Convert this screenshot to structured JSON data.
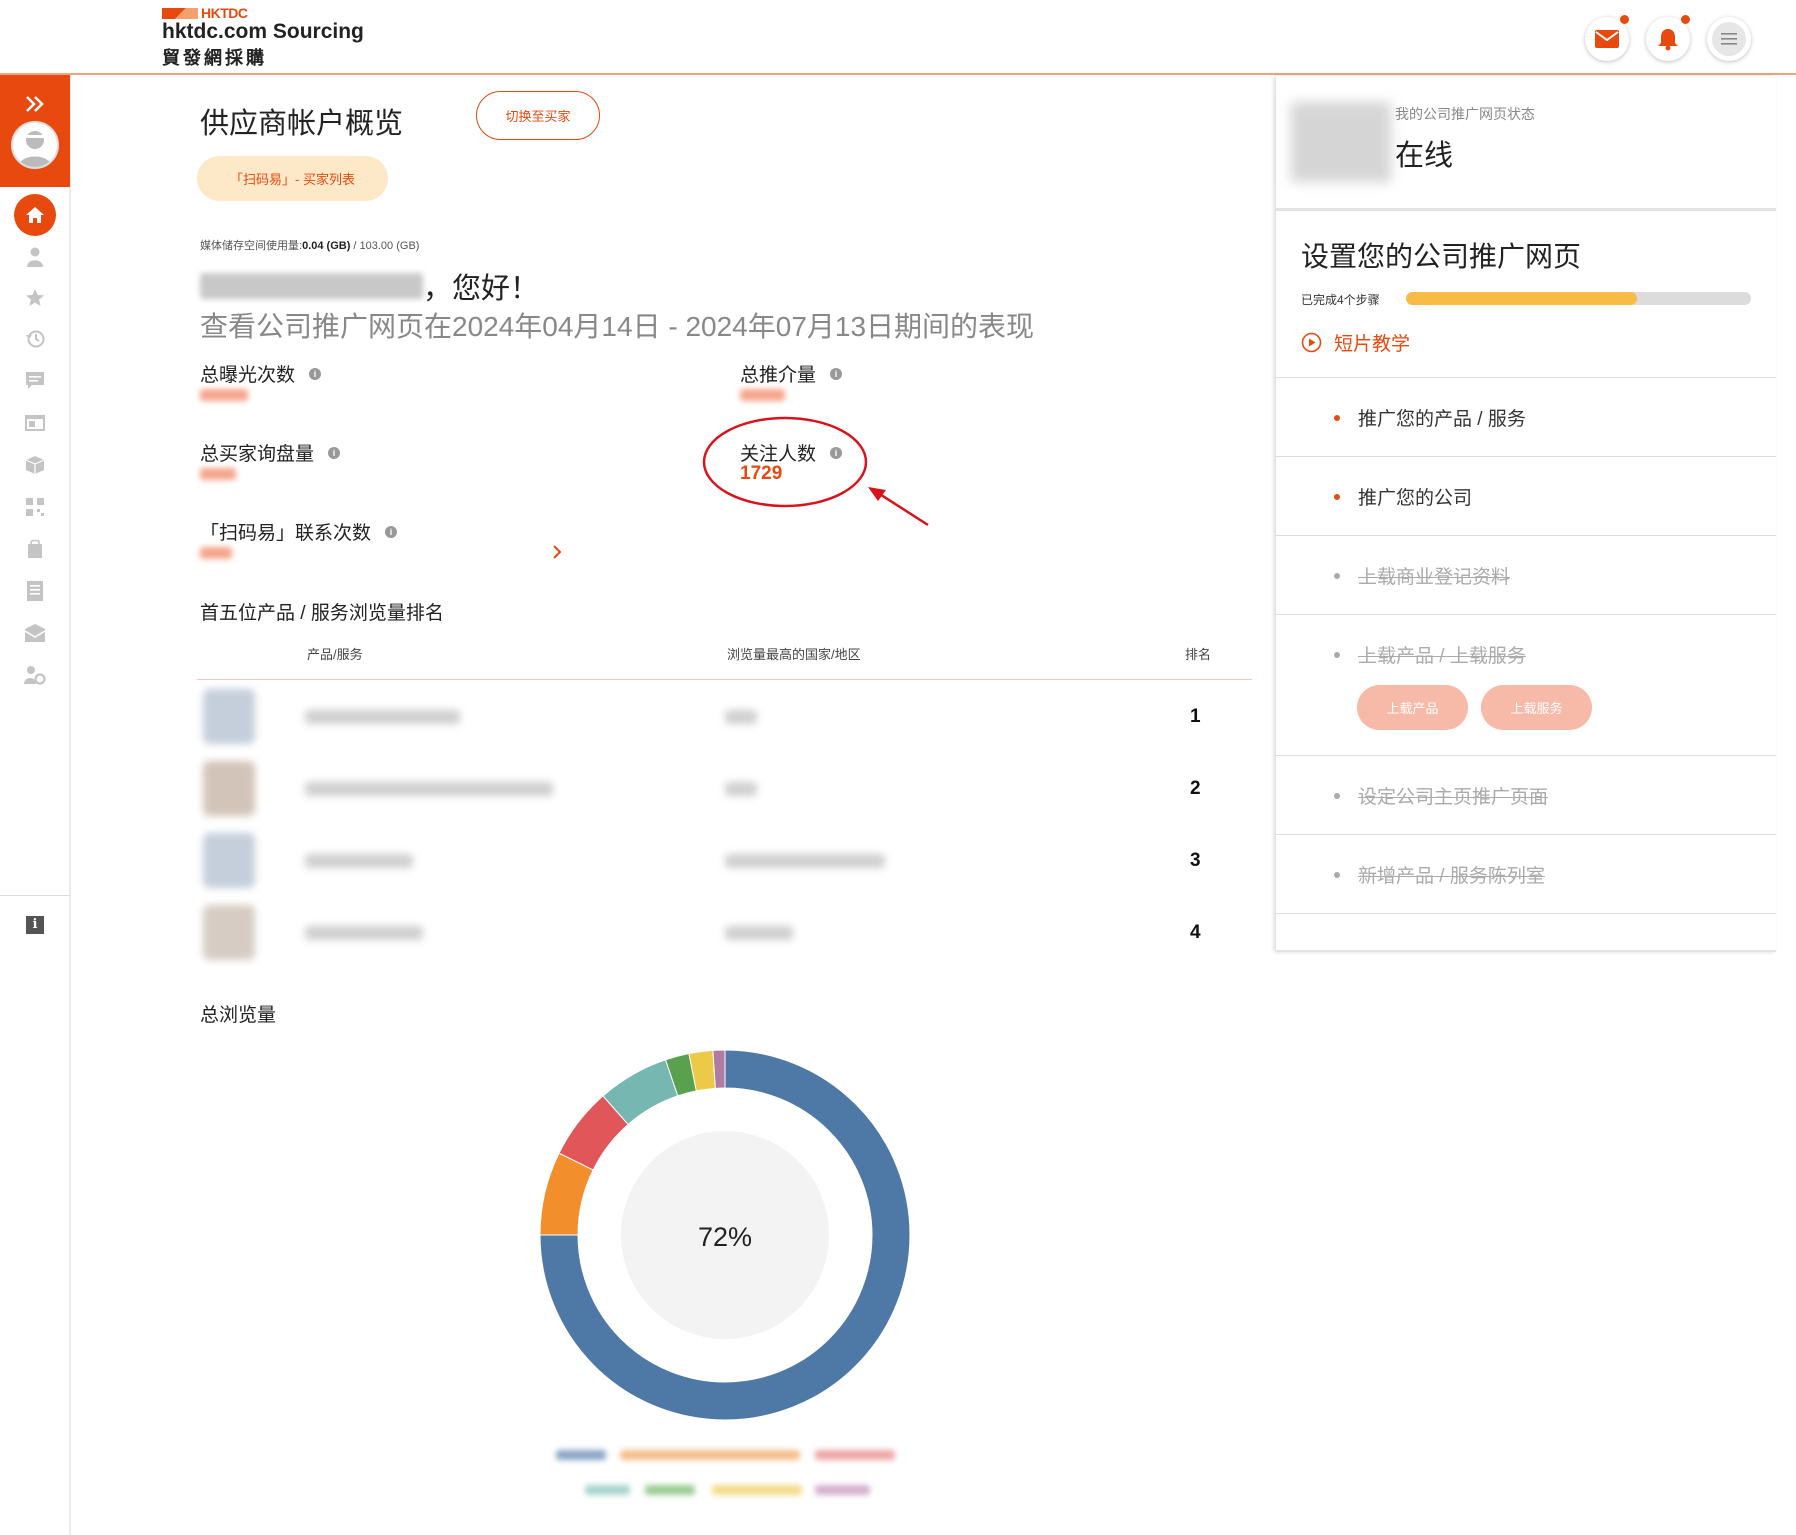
{
  "header": {
    "logo_brand": "HKTDC",
    "logo_main": "hktdc.com Sourcing",
    "logo_sub": "貿發網採購",
    "mail_icon": "mail-icon",
    "bell_icon": "bell-icon",
    "menu_icon": "menu-icon",
    "accent": "#e8490f"
  },
  "sidebar": {
    "items": [
      "expand-icon",
      "avatar",
      "home-icon",
      "user-icon",
      "star-icon",
      "history-icon",
      "message-icon",
      "browser-icon",
      "box-icon",
      "qr-icon",
      "bag-icon",
      "document-icon",
      "inbox-icon",
      "user-settings-icon",
      "info-icon"
    ]
  },
  "main": {
    "title": "供应商帐户概览",
    "switch_button": "切换至买家",
    "scan_pill": "「扫码易」- 买家列表",
    "storage_label": "媒体储存空间使用量:",
    "storage_used": "0.04 (GB)",
    "storage_total": " / 103.00 (GB)",
    "greeting_suffix": "，您好！",
    "subtitle": "查看公司推广网页在2024年04月14日 - 2024年07月13日期间的表现",
    "stats": {
      "exposure_label": "总曝光次数",
      "referral_label": "总推介量",
      "inquiries_label": "总买家询盘量",
      "followers_label": "关注人数",
      "followers_value": "1729",
      "scan_contacts_label": "「扫码易」联系次数"
    },
    "top_products_title": "首五位产品 / 服务浏览量排名",
    "table": {
      "col_product": "产品/服务",
      "col_country": "浏览量最高的国家/地区",
      "col_rank": "排名",
      "ranks": [
        "1",
        "2",
        "3",
        "4"
      ]
    },
    "total_views_title": "总浏览量",
    "donut_center": "72%"
  },
  "chart_data": {
    "type": "pie",
    "title": "",
    "center_label": "72%",
    "series": [
      {
        "values": [
          72,
          7,
          6,
          6,
          2,
          2,
          1
        ]
      }
    ],
    "colors": [
      "#4e79a7",
      "#f28e2b",
      "#e15759",
      "#76b7b2",
      "#59a14f",
      "#edc948",
      "#b07aa1"
    ]
  },
  "right_panel": {
    "status_label": "我的公司推广网页状态",
    "status_value": "在线",
    "setup_title": "设置您的公司推广网页",
    "steps_done": "已完成4个步骤",
    "progress_fraction": 0.67,
    "video_link": "短片教学",
    "tasks": [
      {
        "label": "推广您的产品 / 服务",
        "done": false
      },
      {
        "label": "推广您的公司",
        "done": false
      },
      {
        "label": "上载商业登记资料",
        "done": true
      },
      {
        "label": "上载产品 / 上载服务",
        "done": true
      },
      {
        "label": "设定公司主页推广页面",
        "done": true
      },
      {
        "label": "新增产品 / 服务陈列室",
        "done": true
      }
    ],
    "upload_product": "上载产品",
    "upload_service": "上载服务"
  }
}
